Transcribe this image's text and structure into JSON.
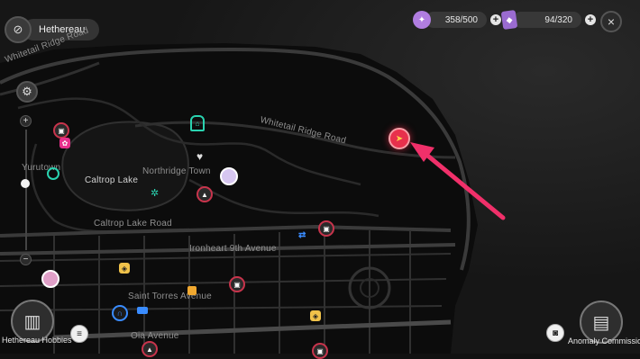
{
  "header": {
    "region_name": "Hethereau",
    "close_label": "×"
  },
  "resources": [
    {
      "icon": "energy-orb-icon",
      "value": "358/500",
      "color": "#b07de0"
    },
    {
      "icon": "purple-card-icon",
      "value": "94/320",
      "color": "#9a6bd0"
    }
  ],
  "map_labels": {
    "whitetail_ridge_road_1": "Whitetail Ridge Road",
    "whitetail_ridge_road_2": "Whitetail Ridge Road",
    "yurutown": "Yurutown",
    "caltrop_lake": "Caltrop Lake",
    "northridge_town": "Northridge Town",
    "caltrop_lake_road": "Caltrop Lake Road",
    "ironheart_9th_avenue": "Ironheart 9th Avenue",
    "saint_torres_avenue": "Saint Torres Avenue",
    "oia_avenue": "Oia Avenue"
  },
  "zoom": {
    "plus": "+",
    "minus": "−",
    "level": 0.5
  },
  "bottom": {
    "hobbies_label": "Hethereau Hobbies",
    "commission_label": "Anomaly Commission"
  },
  "colors": {
    "arrow": "#f0306a",
    "marker": "#e8304c",
    "teal": "#2ad3b0",
    "pink": "#e8308c"
  }
}
